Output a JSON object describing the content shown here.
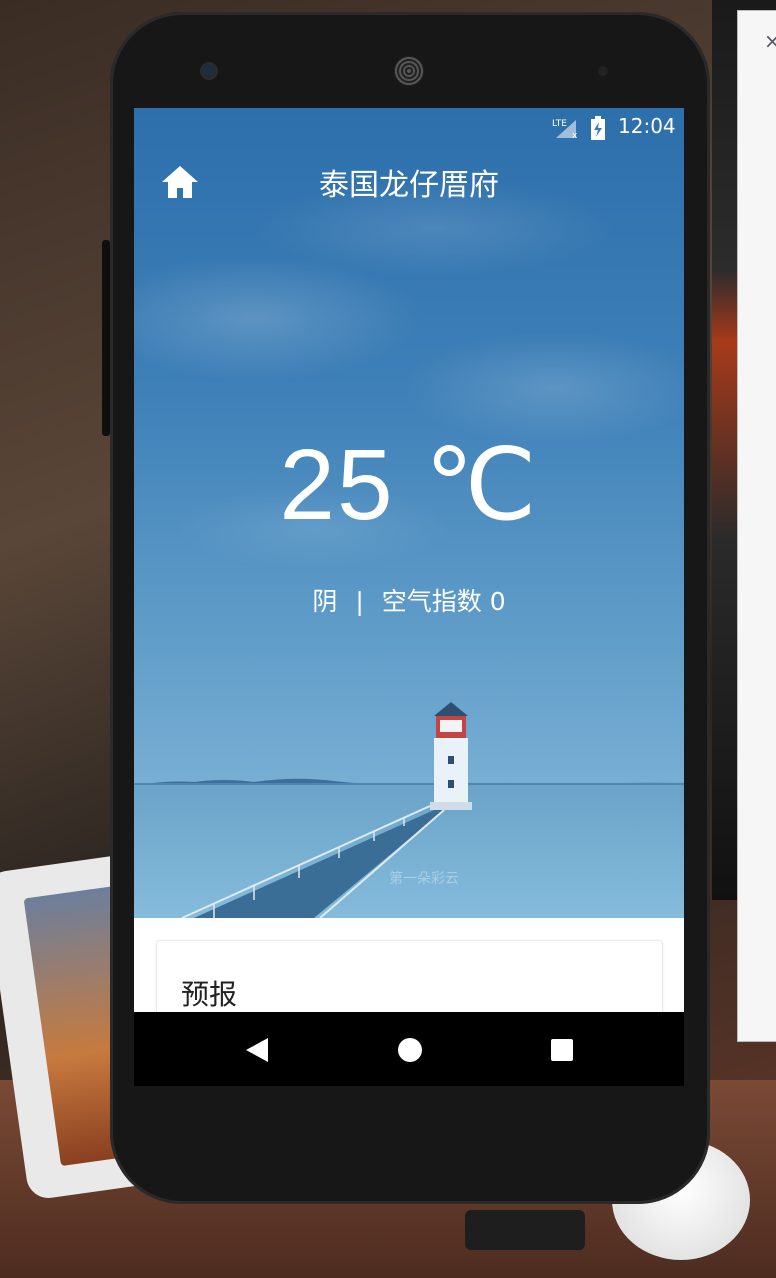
{
  "status_bar": {
    "network": "LTE",
    "time": "12:04",
    "icons": [
      "lte-signal-icon",
      "battery-charging-icon"
    ]
  },
  "header": {
    "home_icon": "home-icon",
    "city": "泰国龙仔厝府"
  },
  "weather": {
    "temperature": "25 ℃",
    "condition": "阴",
    "separator": "|",
    "air_quality": "空气指数 0"
  },
  "watermark": "第一朵彩云",
  "forecast": {
    "title": "预报"
  },
  "nav_bar": {
    "icons": [
      "back-icon",
      "home-circle-icon",
      "recent-apps-icon"
    ]
  },
  "colors": {
    "sky_top": "#2d6fab",
    "sky_bottom": "#8cbedf",
    "nav_background": "#000000",
    "card_background": "#ffffff"
  }
}
